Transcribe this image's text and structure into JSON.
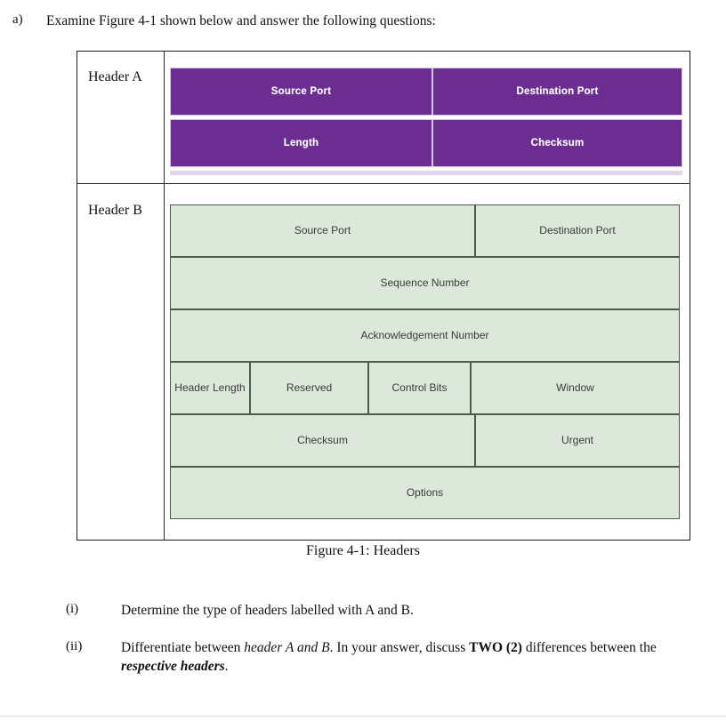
{
  "question": {
    "marker": "a)",
    "prompt": "Examine Figure 4-1 shown below and answer the following questions:"
  },
  "figure": {
    "caption": "Figure 4-1: Headers",
    "colors": {
      "header_a_fill": "#6B2D91",
      "header_a_border": "#d9c4e6",
      "header_b_fill": "#DCE8DA",
      "header_b_border": "#4B5A4B",
      "table_border": "#1c1c1c"
    },
    "rows": [
      {
        "label": "Header A",
        "diagram_rows": [
          {
            "cells": [
              {
                "text": "Source Port"
              },
              {
                "text": "Destination Port"
              }
            ]
          },
          {
            "cells": [
              {
                "text": "Length"
              },
              {
                "text": "Checksum"
              }
            ]
          }
        ]
      },
      {
        "label": "Header B",
        "diagram_rows": [
          {
            "cells": [
              {
                "text": "Source Port"
              },
              {
                "text": "Destination Port"
              }
            ]
          },
          {
            "cells": [
              {
                "text": "Sequence Number"
              }
            ]
          },
          {
            "cells": [
              {
                "text": "Acknowledgement Number"
              }
            ]
          },
          {
            "cells": [
              {
                "text": "Header Length"
              },
              {
                "text": "Reserved"
              },
              {
                "text": "Control Bits"
              },
              {
                "text": "Window"
              }
            ]
          },
          {
            "cells": [
              {
                "text": "Checksum"
              },
              {
                "text": "Urgent"
              }
            ]
          },
          {
            "cells": [
              {
                "text": "Options"
              }
            ]
          }
        ]
      }
    ]
  },
  "sub_questions": [
    {
      "marker": "(i)",
      "text": "Determine the type of headers labelled with A and B."
    },
    {
      "marker": "(ii)",
      "text_parts": [
        {
          "text": "Differentiate between ",
          "style": "normal"
        },
        {
          "text": "header A and B",
          "style": "italic"
        },
        {
          "text": ". In your answer, discuss ",
          "style": "normal"
        },
        {
          "text": "TWO (2)",
          "style": "bold"
        },
        {
          "text": " differences between the ",
          "style": "normal"
        },
        {
          "text": "respective headers",
          "style": "bold-italic"
        },
        {
          "text": ".",
          "style": "normal"
        }
      ]
    }
  ]
}
